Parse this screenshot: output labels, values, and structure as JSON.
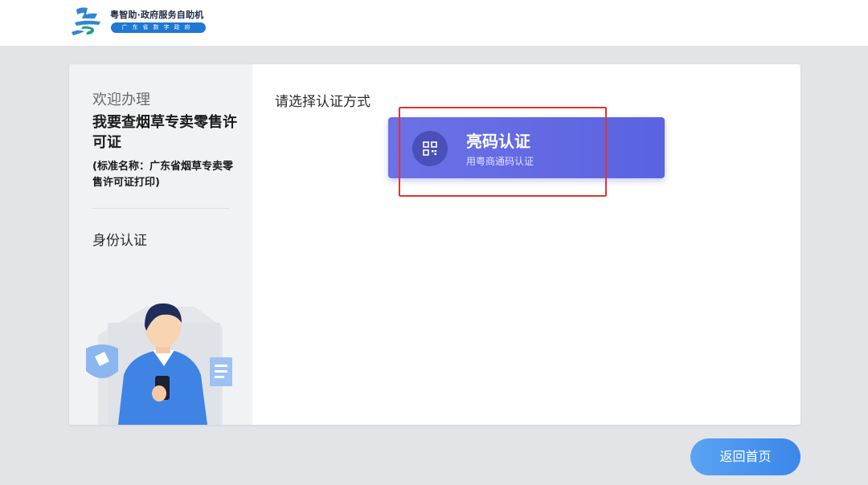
{
  "header": {
    "brand_title": "粤智助·政府服务自助机",
    "brand_subtitle": "广东省数字政府",
    "logo_icon": "yue-logo-icon"
  },
  "sidebar": {
    "welcome": "欢迎办理",
    "service_title": "我要查烟草专卖零售许可证",
    "standard_name": "(标准名称：广东省烟草专卖零售许可证打印)",
    "step_label": "身份认证",
    "illustration_icon": "person-with-phone-illustration"
  },
  "main": {
    "title": "请选择认证方式",
    "auth_option": {
      "title": "亮码认证",
      "subtitle": "用粤商通码认证",
      "icon": "qr-code-icon",
      "color": "#5a63e0"
    }
  },
  "footer": {
    "home_button": "返回首页"
  },
  "colors": {
    "accent": "#3b86ea",
    "highlight": "#e0352f",
    "background": "#e3e4e7"
  }
}
